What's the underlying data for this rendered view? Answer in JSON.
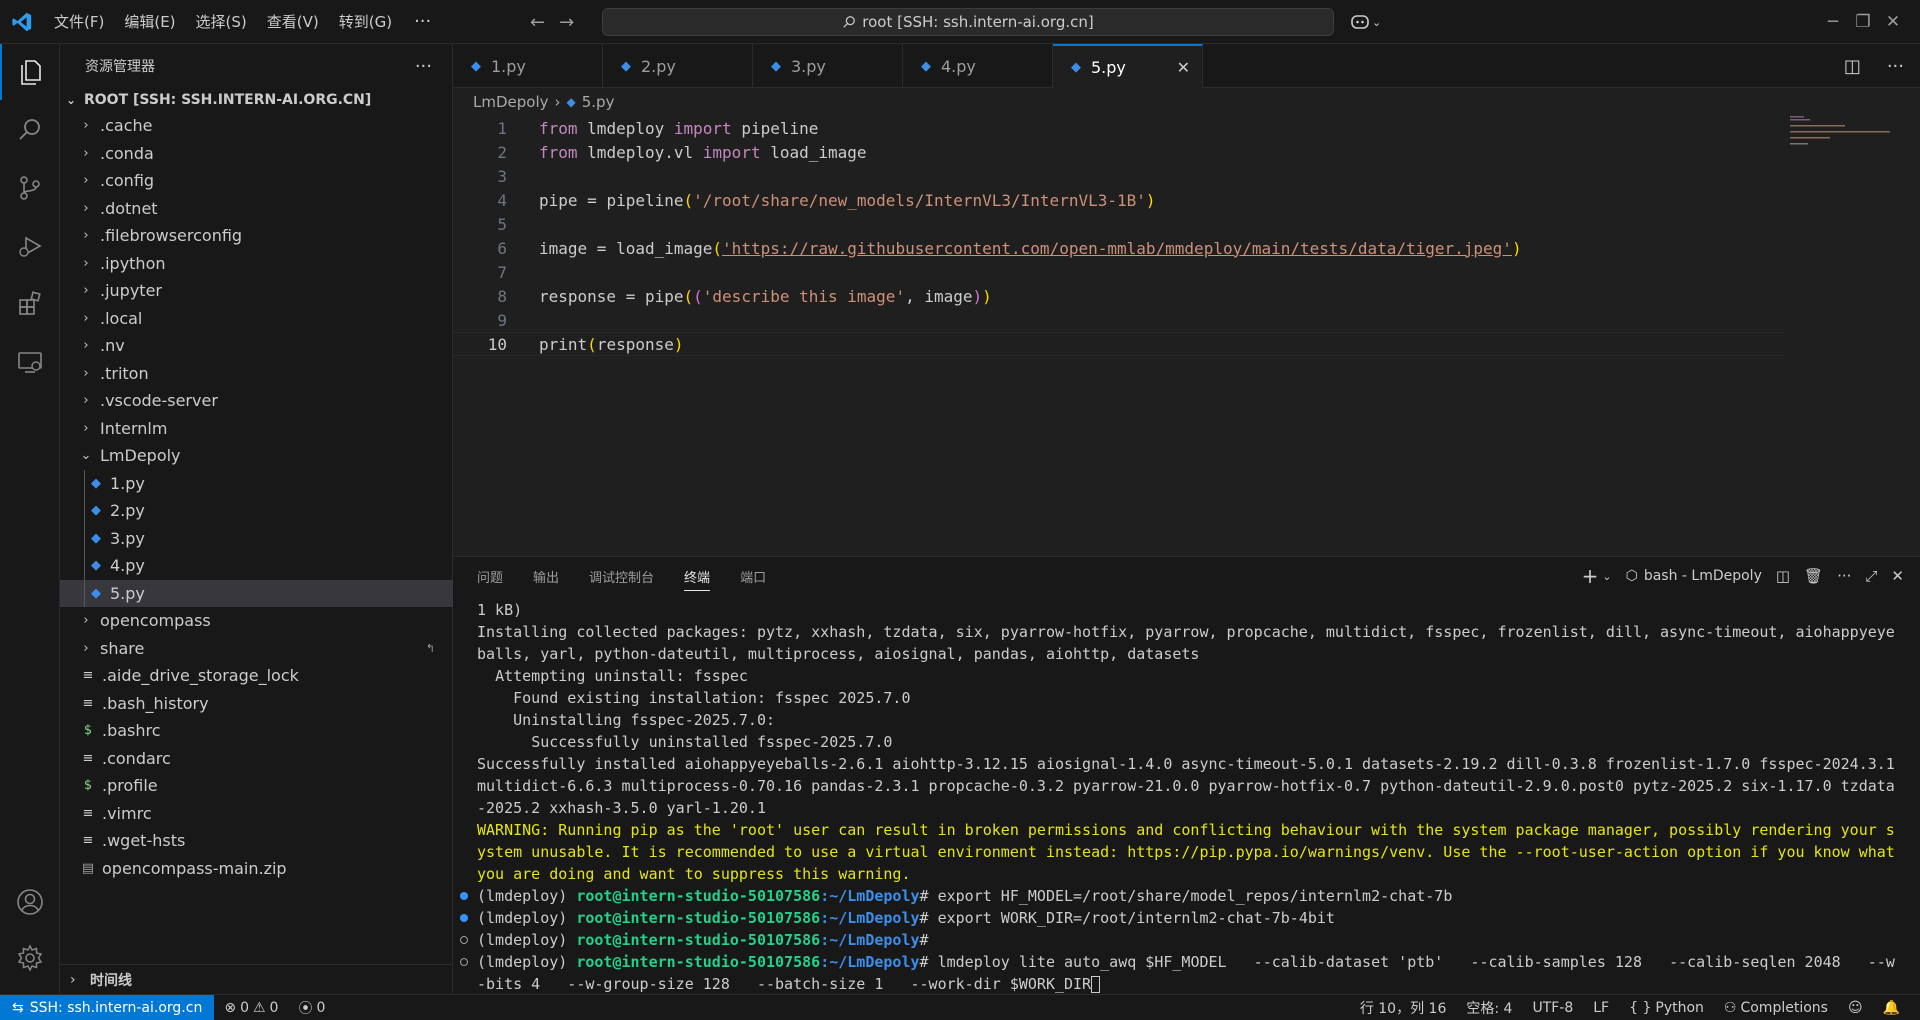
{
  "menu": [
    "文件(F)",
    "编辑(E)",
    "选择(S)",
    "查看(V)",
    "转到(G)"
  ],
  "menu_more": "···",
  "command_center": "root [SSH: ssh.intern-ai.org.cn]",
  "sidebar": {
    "title": "资源管理器",
    "more": "···",
    "root_label": "ROOT [SSH: SSH.INTERN-AI.ORG.CN]",
    "folders": [
      ".cache",
      ".conda",
      ".config",
      ".dotnet",
      ".filebrowserconfig",
      ".ipython",
      ".jupyter",
      ".local",
      ".nv",
      ".triton",
      ".vscode-server",
      "Internlm"
    ],
    "open_folder": "LmDepoly",
    "open_files": [
      "1.py",
      "2.py",
      "3.py",
      "4.py",
      "5.py"
    ],
    "after_folders": [
      "opencompass",
      "share"
    ],
    "files": [
      {
        "name": ".aide_drive_storage_lock",
        "icon": "≡"
      },
      {
        "name": ".bash_history",
        "icon": "≡"
      },
      {
        "name": ".bashrc",
        "icon": "$"
      },
      {
        "name": ".condarc",
        "icon": "≡"
      },
      {
        "name": ".profile",
        "icon": "$"
      },
      {
        "name": ".vimrc",
        "icon": "≡"
      },
      {
        "name": ".wget-hsts",
        "icon": "≡"
      },
      {
        "name": "opencompass-main.zip",
        "icon": "▤"
      }
    ],
    "timeline": "时间线"
  },
  "tabs": [
    "1.py",
    "2.py",
    "3.py",
    "4.py",
    "5.py"
  ],
  "active_tab": "5.py",
  "breadcrumb": {
    "folder": "LmDepoly",
    "file": "5.py"
  },
  "code_lines": [
    {
      "n": "1"
    },
    {
      "n": "2"
    },
    {
      "n": "3"
    },
    {
      "n": "4"
    },
    {
      "n": "5"
    },
    {
      "n": "6"
    },
    {
      "n": "7"
    },
    {
      "n": "8"
    },
    {
      "n": "9"
    },
    {
      "n": "10"
    }
  ],
  "code": {
    "l1_from": "from",
    "l1_mod": "lmdeploy",
    "l1_import": "import",
    "l1_name": "pipeline",
    "l2_from": "from",
    "l2_mod": "lmdeploy.vl",
    "l2_import": "import",
    "l2_name": "load_image",
    "l4_var": "pipe",
    "l4_fn": "pipeline",
    "l4_str": "'/root/share/new_models/InternVL3/InternVL3-1B'",
    "l6_var": "image",
    "l6_fn": "load_image",
    "l6_str": "'https://raw.githubusercontent.com/open-mmlab/mmdeploy/main/tests/data/tiger.jpeg'",
    "l8_var": "response",
    "l8_fn": "pipe",
    "l8_str": "'describe this image'",
    "l8_arg": "image",
    "l10_fn": "print",
    "l10_arg": "response"
  },
  "panel": {
    "tabs": [
      "问题",
      "输出",
      "调试控制台",
      "终端",
      "端口"
    ],
    "active_tab": "终端",
    "terminal_name": "bash - LmDepoly"
  },
  "terminal": {
    "l1": "1 kB)",
    "l2": "Installing collected packages: pytz, xxhash, tzdata, six, pyarrow-hotfix, pyarrow, propcache, multidict, fsspec, frozenlist, dill, async-timeout, aiohappyeyeballs, yarl, python-dateutil, multiprocess, aiosignal, pandas, aiohttp, datasets",
    "l3": "  Attempting uninstall: fsspec",
    "l4": "    Found existing installation: fsspec 2025.7.0",
    "l5": "    Uninstalling fsspec-2025.7.0:",
    "l6": "      Successfully uninstalled fsspec-2025.7.0",
    "l7": "Successfully installed aiohappyeyeballs-2.6.1 aiohttp-3.12.15 aiosignal-1.4.0 async-timeout-5.0.1 datasets-2.19.2 dill-0.3.8 frozenlist-1.7.0 fsspec-2024.3.1 multidict-6.6.3 multiprocess-0.70.16 pandas-2.3.1 propcache-0.3.2 pyarrow-21.0.0 pyarrow-hotfix-0.7 python-dateutil-2.9.0.post0 pytz-2025.2 six-1.17.0 tzdata-2025.2 xxhash-3.5.0 yarl-1.20.1",
    "warn": "WARNING: Running pip as the 'root' user can result in broken permissions and conflicting behaviour with the system package manager, possibly rendering your system unusable. It is recommended to use a virtual environment instead: https://pip.pypa.io/warnings/venv. Use the --root-user-action option if you know what you are doing and want to suppress this warning.",
    "env": "(lmdeploy)",
    "user": "root@intern-studio-50107586",
    "path": ":~/LmDepoly",
    "cmd1": "# export HF_MODEL=/root/share/model_repos/internlm2-chat-7b",
    "cmd2": "# export WORK_DIR=/root/internlm2-chat-7b-4bit",
    "cmd3": "#",
    "cmd4": "# lmdeploy lite auto_awq $HF_MODEL   --calib-dataset 'ptb'   --calib-samples 128   --calib-seqlen 2048   --w-bits 4   --w-group-size 128   --batch-size 1   --work-dir $WORK_DIR"
  },
  "status": {
    "remote": "SSH: ssh.intern-ai.org.cn",
    "errors": "0",
    "warnings": "0",
    "ports": "0",
    "position": "行 10，列 16",
    "spaces": "空格: 4",
    "encoding": "UTF-8",
    "eol": "LF",
    "language": "Python",
    "completions": "Completions"
  },
  "colors": {
    "accent": "#0078d4",
    "background": "#1f1f1f",
    "sidebar": "#181818"
  }
}
